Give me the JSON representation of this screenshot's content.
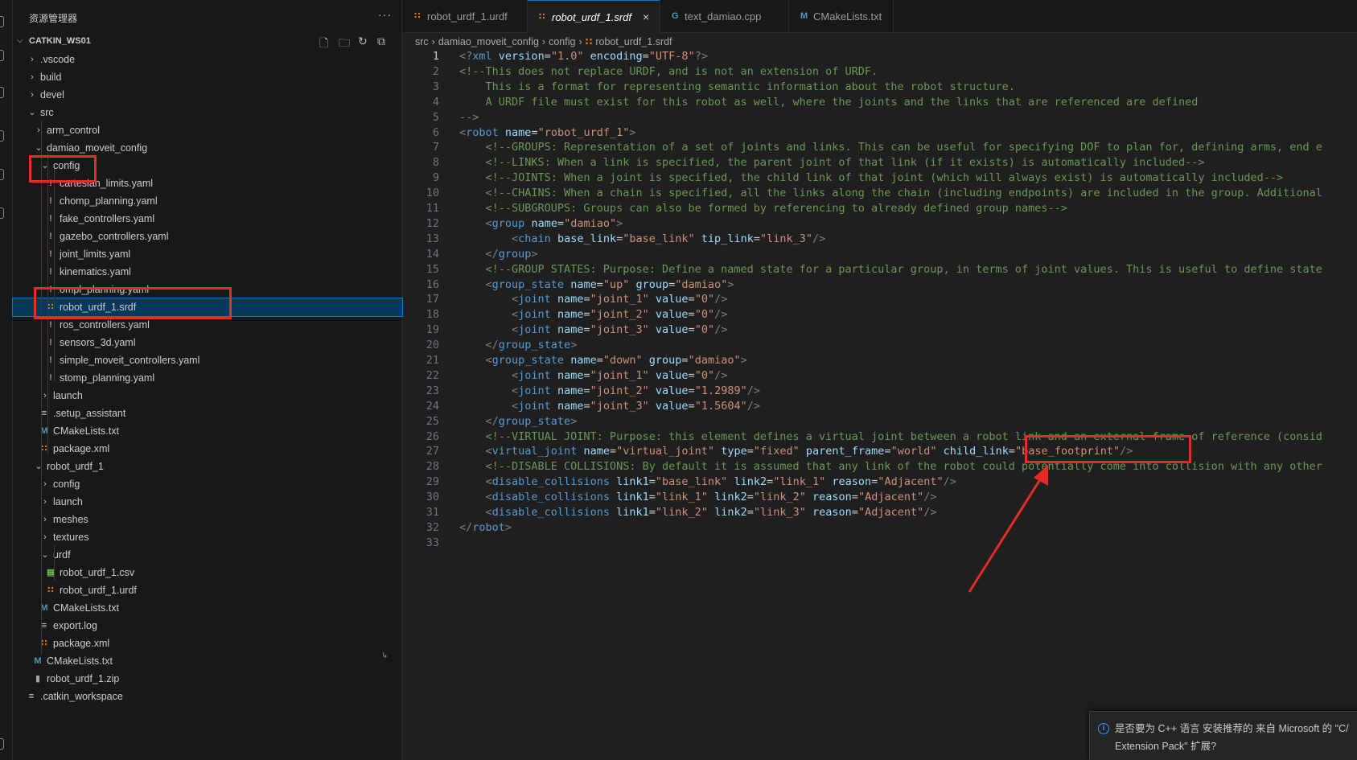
{
  "sidebar": {
    "title": "资源管理器",
    "more": "···",
    "workspace": "CATKIN_WS01",
    "actions": [
      "new-file-icon",
      "new-folder-icon",
      "refresh-icon",
      "collapse-icon"
    ],
    "items": [
      {
        "label": ".vscode",
        "type": "folder",
        "open": false,
        "depth": 1
      },
      {
        "label": "build",
        "type": "folder",
        "open": false,
        "depth": 1
      },
      {
        "label": "devel",
        "type": "folder",
        "open": false,
        "depth": 1
      },
      {
        "label": "src",
        "type": "folder",
        "open": true,
        "depth": 1
      },
      {
        "label": "arm_control",
        "type": "folder",
        "open": false,
        "depth": 2
      },
      {
        "label": "damiao_moveit_config",
        "type": "folder",
        "open": true,
        "depth": 2
      },
      {
        "label": "config",
        "type": "folder",
        "open": true,
        "depth": 3
      },
      {
        "label": "cartesian_limits.yaml",
        "type": "yaml",
        "depth": 4
      },
      {
        "label": "chomp_planning.yaml",
        "type": "yaml",
        "depth": 4
      },
      {
        "label": "fake_controllers.yaml",
        "type": "yaml",
        "depth": 4
      },
      {
        "label": "gazebo_controllers.yaml",
        "type": "yaml",
        "depth": 4
      },
      {
        "label": "joint_limits.yaml",
        "type": "yaml",
        "depth": 4
      },
      {
        "label": "kinematics.yaml",
        "type": "yaml",
        "depth": 4
      },
      {
        "label": "ompl_planning.yaml",
        "type": "yaml",
        "depth": 4
      },
      {
        "label": "robot_urdf_1.srdf",
        "type": "rss",
        "depth": 4,
        "selected": true
      },
      {
        "label": "ros_controllers.yaml",
        "type": "yaml",
        "depth": 4
      },
      {
        "label": "sensors_3d.yaml",
        "type": "yaml",
        "depth": 4
      },
      {
        "label": "simple_moveit_controllers.yaml",
        "type": "yaml",
        "depth": 4
      },
      {
        "label": "stomp_planning.yaml",
        "type": "yaml",
        "depth": 4
      },
      {
        "label": "launch",
        "type": "folder",
        "open": false,
        "depth": 3
      },
      {
        "label": ".setup_assistant",
        "type": "lines",
        "depth": 3
      },
      {
        "label": "CMakeLists.txt",
        "type": "cmake",
        "depth": 3
      },
      {
        "label": "package.xml",
        "type": "rss",
        "depth": 3
      },
      {
        "label": "robot_urdf_1",
        "type": "folder",
        "open": true,
        "depth": 2
      },
      {
        "label": "config",
        "type": "folder",
        "open": false,
        "depth": 3
      },
      {
        "label": "launch",
        "type": "folder",
        "open": false,
        "depth": 3
      },
      {
        "label": "meshes",
        "type": "folder",
        "open": false,
        "depth": 3
      },
      {
        "label": "textures",
        "type": "folder",
        "open": false,
        "depth": 3
      },
      {
        "label": "urdf",
        "type": "folder",
        "open": true,
        "depth": 3
      },
      {
        "label": "robot_urdf_1.csv",
        "type": "csv",
        "depth": 4
      },
      {
        "label": "robot_urdf_1.urdf",
        "type": "rss",
        "depth": 4
      },
      {
        "label": "CMakeLists.txt",
        "type": "cmake",
        "depth": 3
      },
      {
        "label": "export.log",
        "type": "lines",
        "depth": 3
      },
      {
        "label": "package.xml",
        "type": "rss",
        "depth": 3
      },
      {
        "label": "CMakeLists.txt",
        "type": "cmake",
        "depth": 2
      },
      {
        "label": "robot_urdf_1.zip",
        "type": "zip",
        "depth": 2
      },
      {
        "label": ".catkin_workspace",
        "type": "lines",
        "depth": 1
      }
    ]
  },
  "tabs": [
    {
      "label": "robot_urdf_1.urdf",
      "icon": "rss-icon",
      "active": false
    },
    {
      "label": "robot_urdf_1.srdf",
      "icon": "rss-icon",
      "active": true,
      "close": "×"
    },
    {
      "label": "text_damiao.cpp",
      "icon": "cpp-icon",
      "active": false
    },
    {
      "label": "CMakeLists.txt",
      "icon": "cmake-icon",
      "active": false
    }
  ],
  "breadcrumb": [
    "src",
    "damiao_moveit_config",
    "config",
    "robot_urdf_1.srdf"
  ],
  "current_line": 1,
  "code_lines": [
    [
      [
        "b",
        "<?"
      ],
      [
        "tag",
        "xml"
      ],
      [
        "eq",
        " "
      ],
      [
        "att",
        "version"
      ],
      [
        "eq",
        "="
      ],
      [
        "str",
        "\"1.0\""
      ],
      [
        "eq",
        " "
      ],
      [
        "att",
        "encoding"
      ],
      [
        "eq",
        "="
      ],
      [
        "str",
        "\"UTF-8\""
      ],
      [
        "b",
        "?>"
      ]
    ],
    [
      [
        "com",
        "<!--This does not replace URDF, and is not an extension of URDF."
      ]
    ],
    [
      [
        "com",
        "    This is a format for representing semantic information about the robot structure."
      ]
    ],
    [
      [
        "com",
        "    A URDF file must exist for this robot as well, where the joints and the links that are referenced are defined"
      ]
    ],
    [
      [
        "com",
        "-->"
      ]
    ],
    [
      [
        "b",
        "<"
      ],
      [
        "tag",
        "robot"
      ],
      [
        "eq",
        " "
      ],
      [
        "att",
        "name"
      ],
      [
        "eq",
        "="
      ],
      [
        "str",
        "\"robot_urdf_1\""
      ],
      [
        "b",
        ">"
      ]
    ],
    [
      [
        "com",
        "    <!--GROUPS: Representation of a set of joints and links. This can be useful for specifying DOF to plan for, defining arms, end e"
      ]
    ],
    [
      [
        "com",
        "    <!--LINKS: When a link is specified, the parent joint of that link (if it exists) is automatically included-->"
      ]
    ],
    [
      [
        "com",
        "    <!--JOINTS: When a joint is specified, the child link of that joint (which will always exist) is automatically included-->"
      ]
    ],
    [
      [
        "com",
        "    <!--CHAINS: When a chain is specified, all the links along the chain (including endpoints) are included in the group. Additional"
      ]
    ],
    [
      [
        "com",
        "    <!--SUBGROUPS: Groups can also be formed by referencing to already defined group names-->"
      ]
    ],
    [
      [
        "eq",
        "    "
      ],
      [
        "b",
        "<"
      ],
      [
        "tag",
        "group"
      ],
      [
        "eq",
        " "
      ],
      [
        "att",
        "name"
      ],
      [
        "eq",
        "="
      ],
      [
        "str",
        "\"damiao\""
      ],
      [
        "b",
        ">"
      ]
    ],
    [
      [
        "eq",
        "        "
      ],
      [
        "b",
        "<"
      ],
      [
        "tag",
        "chain"
      ],
      [
        "eq",
        " "
      ],
      [
        "att",
        "base_link"
      ],
      [
        "eq",
        "="
      ],
      [
        "str",
        "\"base_link\""
      ],
      [
        "eq",
        " "
      ],
      [
        "att",
        "tip_link"
      ],
      [
        "eq",
        "="
      ],
      [
        "str",
        "\"link_3\""
      ],
      [
        "b",
        "/>"
      ]
    ],
    [
      [
        "eq",
        "    "
      ],
      [
        "b",
        "</"
      ],
      [
        "tag",
        "group"
      ],
      [
        "b",
        ">"
      ]
    ],
    [
      [
        "com",
        "    <!--GROUP STATES: Purpose: Define a named state for a particular group, in terms of joint values. This is useful to define state"
      ]
    ],
    [
      [
        "eq",
        "    "
      ],
      [
        "b",
        "<"
      ],
      [
        "tag",
        "group_state"
      ],
      [
        "eq",
        " "
      ],
      [
        "att",
        "name"
      ],
      [
        "eq",
        "="
      ],
      [
        "str",
        "\"up\""
      ],
      [
        "eq",
        " "
      ],
      [
        "att",
        "group"
      ],
      [
        "eq",
        "="
      ],
      [
        "str",
        "\"damiao\""
      ],
      [
        "b",
        ">"
      ]
    ],
    [
      [
        "eq",
        "        "
      ],
      [
        "b",
        "<"
      ],
      [
        "tag",
        "joint"
      ],
      [
        "eq",
        " "
      ],
      [
        "att",
        "name"
      ],
      [
        "eq",
        "="
      ],
      [
        "str",
        "\"joint_1\""
      ],
      [
        "eq",
        " "
      ],
      [
        "att",
        "value"
      ],
      [
        "eq",
        "="
      ],
      [
        "str",
        "\"0\""
      ],
      [
        "b",
        "/>"
      ]
    ],
    [
      [
        "eq",
        "        "
      ],
      [
        "b",
        "<"
      ],
      [
        "tag",
        "joint"
      ],
      [
        "eq",
        " "
      ],
      [
        "att",
        "name"
      ],
      [
        "eq",
        "="
      ],
      [
        "str",
        "\"joint_2\""
      ],
      [
        "eq",
        " "
      ],
      [
        "att",
        "value"
      ],
      [
        "eq",
        "="
      ],
      [
        "str",
        "\"0\""
      ],
      [
        "b",
        "/>"
      ]
    ],
    [
      [
        "eq",
        "        "
      ],
      [
        "b",
        "<"
      ],
      [
        "tag",
        "joint"
      ],
      [
        "eq",
        " "
      ],
      [
        "att",
        "name"
      ],
      [
        "eq",
        "="
      ],
      [
        "str",
        "\"joint_3\""
      ],
      [
        "eq",
        " "
      ],
      [
        "att",
        "value"
      ],
      [
        "eq",
        "="
      ],
      [
        "str",
        "\"0\""
      ],
      [
        "b",
        "/>"
      ]
    ],
    [
      [
        "eq",
        "    "
      ],
      [
        "b",
        "</"
      ],
      [
        "tag",
        "group_state"
      ],
      [
        "b",
        ">"
      ]
    ],
    [
      [
        "eq",
        "    "
      ],
      [
        "b",
        "<"
      ],
      [
        "tag",
        "group_state"
      ],
      [
        "eq",
        " "
      ],
      [
        "att",
        "name"
      ],
      [
        "eq",
        "="
      ],
      [
        "str",
        "\"down\""
      ],
      [
        "eq",
        " "
      ],
      [
        "att",
        "group"
      ],
      [
        "eq",
        "="
      ],
      [
        "str",
        "\"damiao\""
      ],
      [
        "b",
        ">"
      ]
    ],
    [
      [
        "eq",
        "        "
      ],
      [
        "b",
        "<"
      ],
      [
        "tag",
        "joint"
      ],
      [
        "eq",
        " "
      ],
      [
        "att",
        "name"
      ],
      [
        "eq",
        "="
      ],
      [
        "str",
        "\"joint_1\""
      ],
      [
        "eq",
        " "
      ],
      [
        "att",
        "value"
      ],
      [
        "eq",
        "="
      ],
      [
        "str",
        "\"0\""
      ],
      [
        "b",
        "/>"
      ]
    ],
    [
      [
        "eq",
        "        "
      ],
      [
        "b",
        "<"
      ],
      [
        "tag",
        "joint"
      ],
      [
        "eq",
        " "
      ],
      [
        "att",
        "name"
      ],
      [
        "eq",
        "="
      ],
      [
        "str",
        "\"joint_2\""
      ],
      [
        "eq",
        " "
      ],
      [
        "att",
        "value"
      ],
      [
        "eq",
        "="
      ],
      [
        "str",
        "\"1.2989\""
      ],
      [
        "b",
        "/>"
      ]
    ],
    [
      [
        "eq",
        "        "
      ],
      [
        "b",
        "<"
      ],
      [
        "tag",
        "joint"
      ],
      [
        "eq",
        " "
      ],
      [
        "att",
        "name"
      ],
      [
        "eq",
        "="
      ],
      [
        "str",
        "\"joint_3\""
      ],
      [
        "eq",
        " "
      ],
      [
        "att",
        "value"
      ],
      [
        "eq",
        "="
      ],
      [
        "str",
        "\"1.5604\""
      ],
      [
        "b",
        "/>"
      ]
    ],
    [
      [
        "eq",
        "    "
      ],
      [
        "b",
        "</"
      ],
      [
        "tag",
        "group_state"
      ],
      [
        "b",
        ">"
      ]
    ],
    [
      [
        "com",
        "    <!--VIRTUAL JOINT: Purpose: this element defines a virtual joint between a robot link and an external frame of reference (consid"
      ]
    ],
    [
      [
        "eq",
        "    "
      ],
      [
        "b",
        "<"
      ],
      [
        "tag",
        "virtual_joint"
      ],
      [
        "eq",
        " "
      ],
      [
        "att",
        "name"
      ],
      [
        "eq",
        "="
      ],
      [
        "str",
        "\"virtual_joint\""
      ],
      [
        "eq",
        " "
      ],
      [
        "att",
        "type"
      ],
      [
        "eq",
        "="
      ],
      [
        "str",
        "\"fixed\""
      ],
      [
        "eq",
        " "
      ],
      [
        "att",
        "parent_frame"
      ],
      [
        "eq",
        "="
      ],
      [
        "str",
        "\"world\""
      ],
      [
        "eq",
        " "
      ],
      [
        "att",
        "child_link"
      ],
      [
        "eq",
        "="
      ],
      [
        "str",
        "\"base_footprint\""
      ],
      [
        "b",
        "/>"
      ]
    ],
    [
      [
        "com",
        "    <!--DISABLE COLLISIONS: By default it is assumed that any link of the robot could potentially come into collision with any other"
      ]
    ],
    [
      [
        "eq",
        "    "
      ],
      [
        "b",
        "<"
      ],
      [
        "tag",
        "disable_collisions"
      ],
      [
        "eq",
        " "
      ],
      [
        "att",
        "link1"
      ],
      [
        "eq",
        "="
      ],
      [
        "str",
        "\"base_link\""
      ],
      [
        "eq",
        " "
      ],
      [
        "att",
        "link2"
      ],
      [
        "eq",
        "="
      ],
      [
        "str",
        "\"link_1\""
      ],
      [
        "eq",
        " "
      ],
      [
        "att",
        "reason"
      ],
      [
        "eq",
        "="
      ],
      [
        "str",
        "\"Adjacent\""
      ],
      [
        "b",
        "/>"
      ]
    ],
    [
      [
        "eq",
        "    "
      ],
      [
        "b",
        "<"
      ],
      [
        "tag",
        "disable_collisions"
      ],
      [
        "eq",
        " "
      ],
      [
        "att",
        "link1"
      ],
      [
        "eq",
        "="
      ],
      [
        "str",
        "\"link_1\""
      ],
      [
        "eq",
        " "
      ],
      [
        "att",
        "link2"
      ],
      [
        "eq",
        "="
      ],
      [
        "str",
        "\"link_2\""
      ],
      [
        "eq",
        " "
      ],
      [
        "att",
        "reason"
      ],
      [
        "eq",
        "="
      ],
      [
        "str",
        "\"Adjacent\""
      ],
      [
        "b",
        "/>"
      ]
    ],
    [
      [
        "eq",
        "    "
      ],
      [
        "b",
        "<"
      ],
      [
        "tag",
        "disable_collisions"
      ],
      [
        "eq",
        " "
      ],
      [
        "att",
        "link1"
      ],
      [
        "eq",
        "="
      ],
      [
        "str",
        "\"link_2\""
      ],
      [
        "eq",
        " "
      ],
      [
        "att",
        "link2"
      ],
      [
        "eq",
        "="
      ],
      [
        "str",
        "\"link_3\""
      ],
      [
        "eq",
        " "
      ],
      [
        "att",
        "reason"
      ],
      [
        "eq",
        "="
      ],
      [
        "str",
        "\"Adjacent\""
      ],
      [
        "b",
        "/>"
      ]
    ],
    [
      [
        "b",
        "</"
      ],
      [
        "tag",
        "robot"
      ],
      [
        "b",
        ">"
      ]
    ],
    []
  ],
  "notification": {
    "text": "是否要为 C++ 语言 安装推荐的 来自 Microsoft 的 \"C/ Extension Pack\" 扩展?"
  },
  "colors": {
    "selection": "#04395e",
    "annotation": "#e52d27",
    "accent": "#0078d4"
  }
}
